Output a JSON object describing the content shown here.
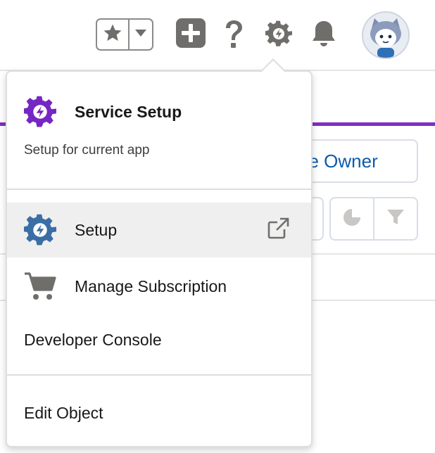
{
  "header": {
    "favorites": {
      "star_icon": "star-icon",
      "caret_icon": "chevron-down-icon"
    },
    "icons": [
      "plus-icon",
      "help-icon",
      "gear-icon",
      "bell-icon"
    ],
    "avatar_icon": "astro-avatar-icon"
  },
  "background": {
    "owner_button_label": "ge Owner"
  },
  "setup_menu": {
    "title": "Service Setup",
    "subtitle": "Setup for current app",
    "items": [
      {
        "label": "Setup",
        "icon": "setup-gear-icon",
        "external_icon": "external-link-icon",
        "highlighted": true
      },
      {
        "label": "Manage Subscription",
        "icon": "cart-icon"
      },
      {
        "label": "Developer Console"
      },
      {
        "label": "Edit Object"
      }
    ]
  },
  "colors": {
    "accent": "#7f2ec2",
    "service_gear": "#7526c4",
    "setup_gear": "#3a6ea5",
    "link": "#0b5cab",
    "icon_gray": "#706e6b"
  }
}
